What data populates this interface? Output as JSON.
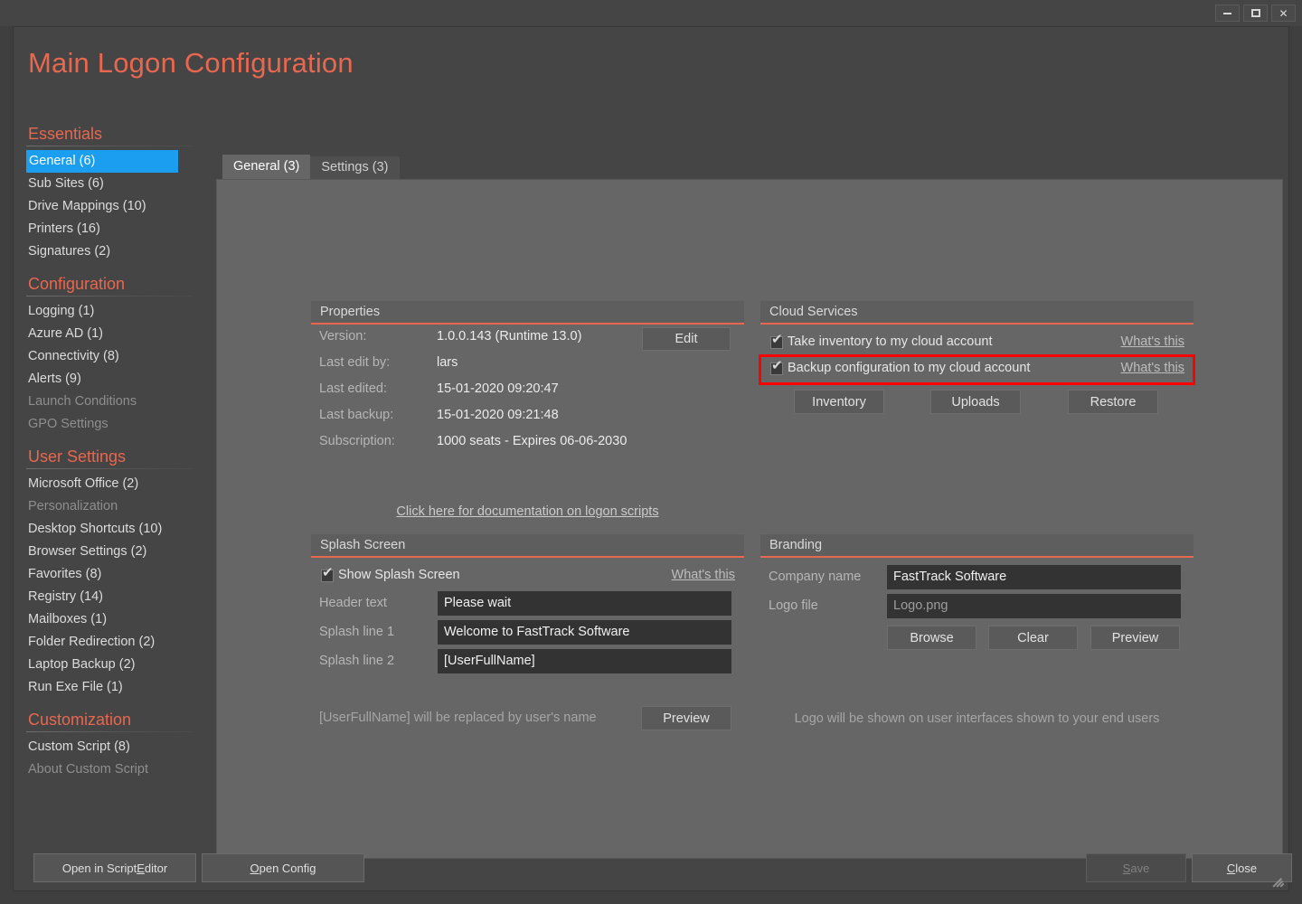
{
  "window": {
    "title_bar_buttons": [
      {
        "name": "minimize",
        "glyph": "—"
      },
      {
        "name": "maximize",
        "glyph": "□"
      },
      {
        "name": "close",
        "glyph": "✕"
      }
    ]
  },
  "page_title": "Main Logon Configuration",
  "accent_color": "#e8674f",
  "selection_color": "#1b9df0",
  "highlight_color": "#ff0000",
  "sidebar": {
    "sections": [
      {
        "header": "Essentials",
        "items": [
          {
            "label": "General (6)",
            "selected": true,
            "disabled": false
          },
          {
            "label": "Sub Sites (6)",
            "selected": false,
            "disabled": false
          },
          {
            "label": "Drive Mappings (10)",
            "selected": false,
            "disabled": false
          },
          {
            "label": "Printers (16)",
            "selected": false,
            "disabled": false
          },
          {
            "label": "Signatures (2)",
            "selected": false,
            "disabled": false
          }
        ]
      },
      {
        "header": "Configuration",
        "items": [
          {
            "label": "Logging (1)",
            "selected": false,
            "disabled": false
          },
          {
            "label": "Azure AD (1)",
            "selected": false,
            "disabled": false
          },
          {
            "label": "Connectivity (8)",
            "selected": false,
            "disabled": false
          },
          {
            "label": "Alerts (9)",
            "selected": false,
            "disabled": false
          },
          {
            "label": "Launch Conditions",
            "selected": false,
            "disabled": true
          },
          {
            "label": "GPO Settings",
            "selected": false,
            "disabled": true
          }
        ]
      },
      {
        "header": "User Settings",
        "items": [
          {
            "label": "Microsoft Office (2)",
            "selected": false,
            "disabled": false
          },
          {
            "label": "Personalization",
            "selected": false,
            "disabled": true
          },
          {
            "label": "Desktop Shortcuts (10)",
            "selected": false,
            "disabled": false
          },
          {
            "label": "Browser Settings (2)",
            "selected": false,
            "disabled": false
          },
          {
            "label": "Favorites (8)",
            "selected": false,
            "disabled": false
          },
          {
            "label": "Registry (14)",
            "selected": false,
            "disabled": false
          },
          {
            "label": "Mailboxes (1)",
            "selected": false,
            "disabled": false
          },
          {
            "label": "Folder Redirection (2)",
            "selected": false,
            "disabled": false
          },
          {
            "label": "Laptop Backup (2)",
            "selected": false,
            "disabled": false
          },
          {
            "label": "Run Exe File (1)",
            "selected": false,
            "disabled": false
          }
        ]
      },
      {
        "header": "Customization",
        "items": [
          {
            "label": "Custom Script (8)",
            "selected": false,
            "disabled": false
          },
          {
            "label": "About Custom Script",
            "selected": false,
            "disabled": true
          }
        ]
      }
    ]
  },
  "tabs": [
    {
      "label": "General (3)",
      "active": true
    },
    {
      "label": "Settings (3)",
      "active": false
    }
  ],
  "properties": {
    "header": "Properties",
    "rows": [
      {
        "label": "Version:",
        "value": "1.0.0.143 (Runtime 13.0)"
      },
      {
        "label": "Last edit by:",
        "value": "lars"
      },
      {
        "label": "Last edited:",
        "value": "15-01-2020 09:20:47"
      },
      {
        "label": "Last backup:",
        "value": "15-01-2020 09:21:48"
      },
      {
        "label": "Subscription:",
        "value": "1000 seats  -  Expires 06-06-2030"
      }
    ],
    "edit_button": "Edit",
    "documentation_link": "Click here for documentation on logon scripts"
  },
  "cloud_services": {
    "header": "Cloud Services",
    "checkboxes": [
      {
        "label": "Take inventory to my cloud account",
        "checked": true,
        "link": "What's this",
        "highlighted": true
      },
      {
        "label": "Backup configuration to my cloud account",
        "checked": true,
        "link": "What's this",
        "highlighted": false
      }
    ],
    "buttons": {
      "inventory": "Inventory",
      "uploads": "Uploads",
      "restore": "Restore"
    }
  },
  "splash_screen": {
    "header": "Splash Screen",
    "show_checkbox": {
      "label": "Show Splash Screen",
      "checked": true
    },
    "whats_this": "What's this",
    "fields": [
      {
        "label": "Header text",
        "value": "Please wait"
      },
      {
        "label": "Splash line 1",
        "value": "Welcome to FastTrack Software"
      },
      {
        "label": "Splash line 2",
        "value": "[UserFullName]"
      }
    ],
    "note": "[UserFullName] will be replaced by user's name",
    "preview_button": "Preview"
  },
  "branding": {
    "header": "Branding",
    "fields": [
      {
        "label": "Company name",
        "value": "FastTrack Software",
        "placeholder": ""
      },
      {
        "label": "Logo file",
        "value": "",
        "placeholder": "Logo.png"
      }
    ],
    "buttons": {
      "browse": "Browse",
      "clear": "Clear",
      "preview": "Preview"
    },
    "note": "Logo will be shown on user interfaces shown to your end users"
  },
  "bottom_bar": {
    "script_editor": {
      "before": "Open in Script ",
      "accel": "E",
      "after": "ditor"
    },
    "open_config": {
      "before": "",
      "accel": "O",
      "after": "pen Config"
    },
    "save": {
      "before": "",
      "accel": "S",
      "after": "ave",
      "disabled": true
    },
    "close": {
      "before": "",
      "accel": "C",
      "after": "lose",
      "disabled": false
    }
  }
}
